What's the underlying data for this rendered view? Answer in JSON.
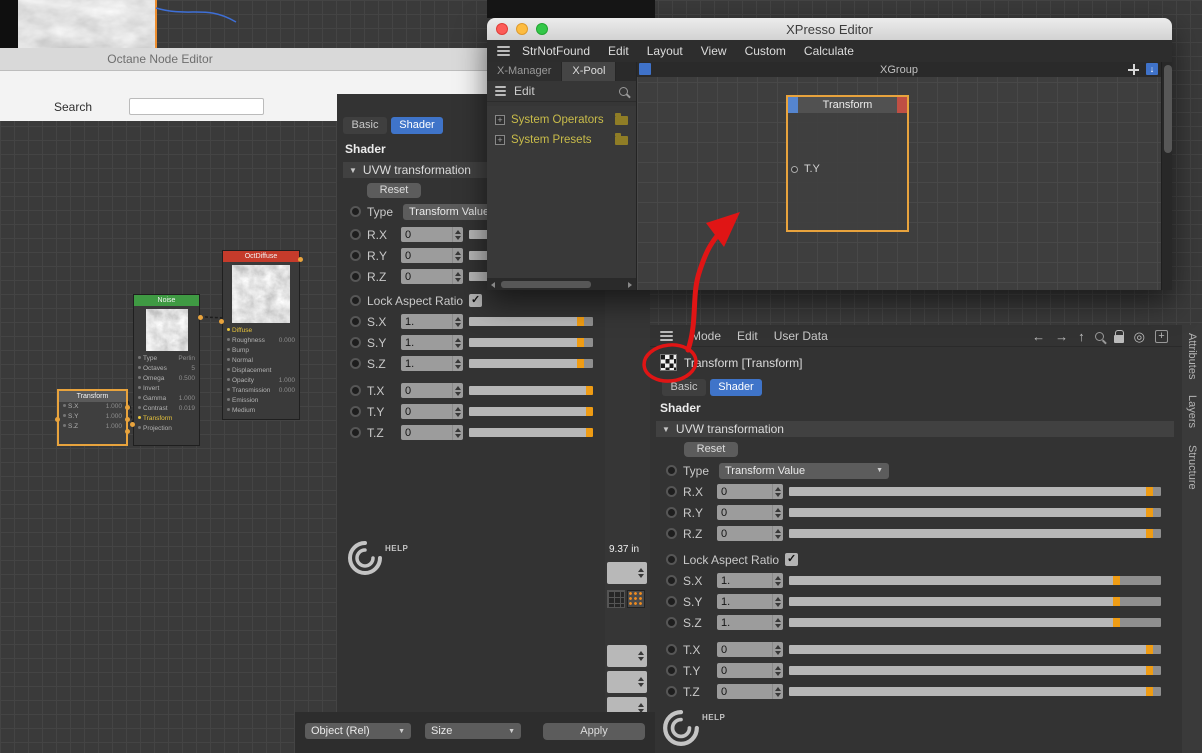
{
  "octane": {
    "title": "Octane Node Editor",
    "search_label": "Search",
    "search_value": "",
    "nodes": {
      "transform": {
        "title": "Transform",
        "rows": [
          {
            "label": "S.X",
            "value": "1.000"
          },
          {
            "label": "S.Y",
            "value": "1.000"
          },
          {
            "label": "S.Z",
            "value": "1.000"
          }
        ]
      },
      "noise": {
        "title": "Noise",
        "rows": [
          {
            "label": "Type",
            "value": "Perlin"
          },
          {
            "label": "Octaves",
            "value": "5"
          },
          {
            "label": "Omega",
            "value": "0.500"
          },
          {
            "label": "Invert",
            "value": ""
          },
          {
            "label": "Gamma",
            "value": "1.000"
          },
          {
            "label": "Contrast",
            "value": "0.019"
          },
          {
            "label": "Transform",
            "value": ""
          },
          {
            "label": "Projection",
            "value": ""
          }
        ]
      },
      "octdiffuse": {
        "title": "OctDiffuse",
        "rows": [
          {
            "label": "Diffuse",
            "value": ""
          },
          {
            "label": "Roughness",
            "value": "0.000"
          },
          {
            "label": "Bump",
            "value": ""
          },
          {
            "label": "Normal",
            "value": ""
          },
          {
            "label": "Displacement",
            "value": ""
          },
          {
            "label": "Opacity",
            "value": "1.000"
          },
          {
            "label": "Transmission",
            "value": "0.000"
          },
          {
            "label": "Emission",
            "value": ""
          },
          {
            "label": "Medium",
            "value": ""
          }
        ]
      }
    }
  },
  "xpresso": {
    "title": "XPresso Editor",
    "menu": [
      "StrNotFound",
      "Edit",
      "Layout",
      "View",
      "Custom",
      "Calculate"
    ],
    "pool": {
      "tabs": [
        "X-Manager",
        "X-Pool"
      ],
      "edit_label": "Edit",
      "tree": [
        "System Operators",
        "System Presets"
      ]
    },
    "canvas": {
      "group_title": "XGroup",
      "node": {
        "title": "Transform",
        "port": "T.Y"
      }
    }
  },
  "shader": {
    "tabs": [
      "Basic",
      "Shader"
    ],
    "active_tab": "Shader",
    "heading": "Shader",
    "section": "UVW transformation",
    "reset": "Reset",
    "type_label": "Type",
    "type_value": "Transform Value",
    "lock_label": "Lock Aspect Ratio",
    "lock_checked": true,
    "r_rows": [
      {
        "label": "R.X",
        "value": "0"
      },
      {
        "label": "R.Y",
        "value": "0"
      },
      {
        "label": "R.Z",
        "value": "0"
      }
    ],
    "s_rows": [
      {
        "label": "S.X",
        "value": "1."
      },
      {
        "label": "S.Y",
        "value": "1."
      },
      {
        "label": "S.Z",
        "value": "1."
      }
    ],
    "t_rows": [
      {
        "label": "T.X",
        "value": "0"
      },
      {
        "label": "T.Y",
        "value": "0"
      },
      {
        "label": "T.Z",
        "value": "0"
      }
    ]
  },
  "attr": {
    "menu": [
      "Mode",
      "Edit",
      "User Data"
    ],
    "object_title": "Transform [Transform]"
  },
  "side_tabs": [
    "Attributes",
    "Layers",
    "Structure"
  ],
  "footer": {
    "object_rel": "Object (Rel)",
    "size_label": "Size",
    "apply": "Apply"
  },
  "misc": {
    "measure": "9.37 in",
    "help": "HELP"
  },
  "accent_colors": {
    "selection_orange": "#e8a33d",
    "slider_orange": "#ef9c14",
    "tab_blue": "#3f74c9",
    "annotation_red": "#e01515",
    "tree_yellow": "#c9bc4a"
  },
  "icons": {
    "check": "✓",
    "dropdown_caret": "▼",
    "section_caret": "▼",
    "back": "←",
    "forward": "→",
    "up": "↑",
    "down": "↓",
    "target": "◎",
    "plus": "+",
    "tree_expand": "+"
  }
}
